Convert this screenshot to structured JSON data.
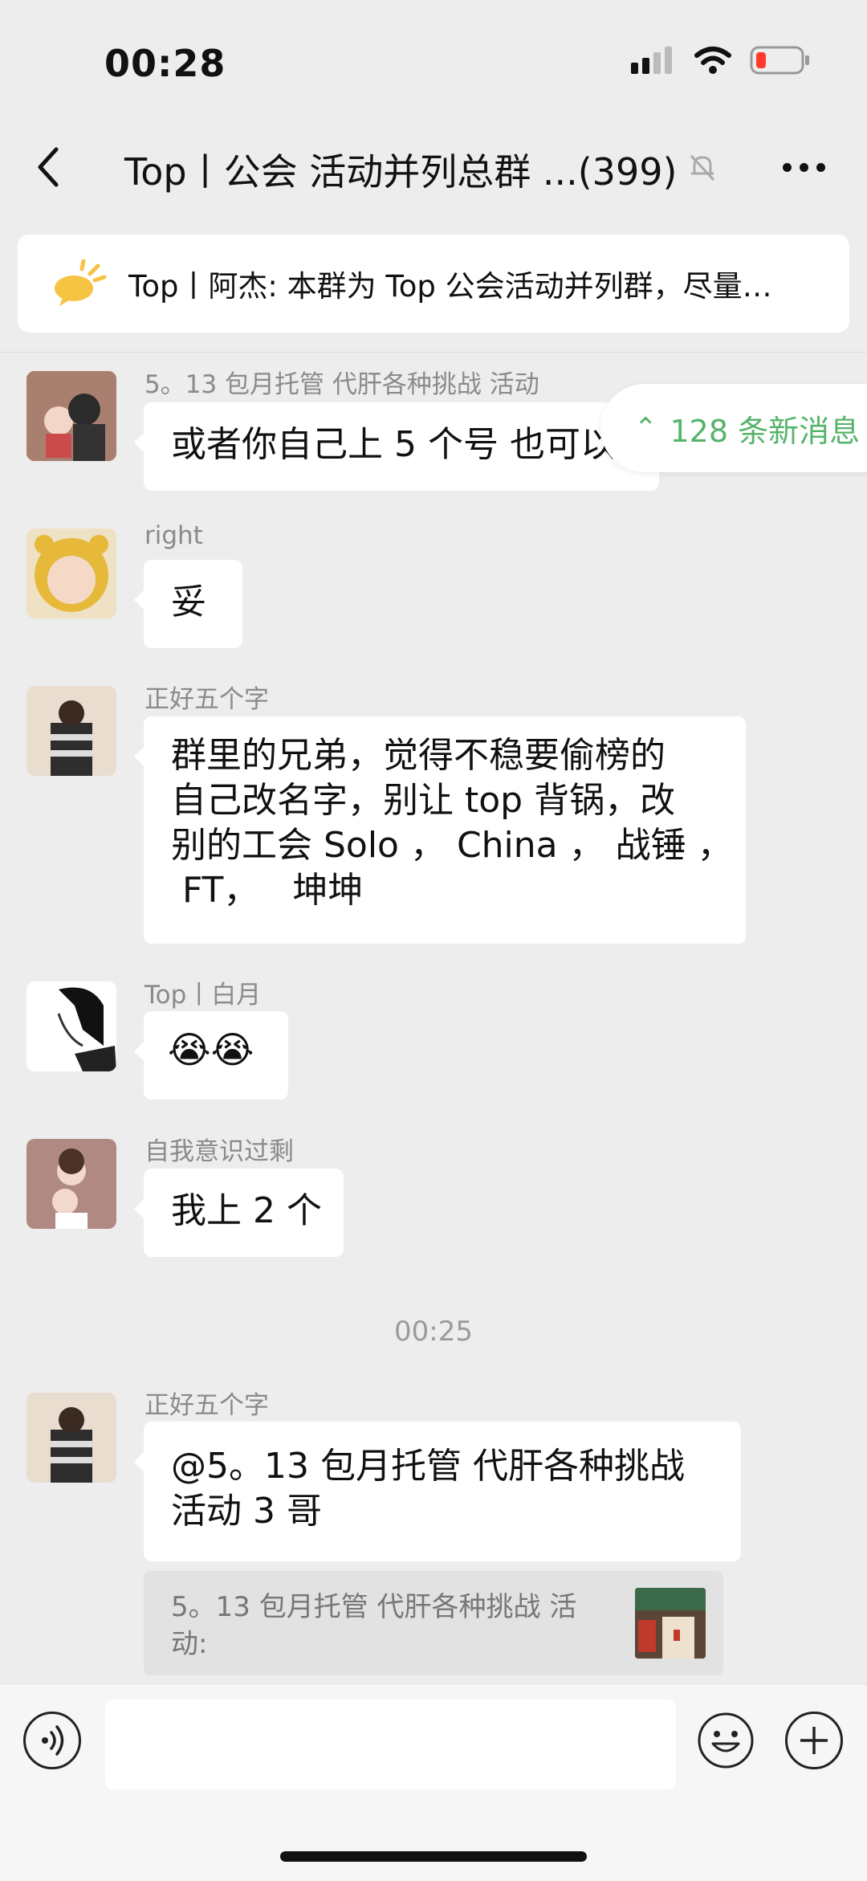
{
  "status_bar": {
    "time": "00:28",
    "icons": [
      "signal-icon",
      "wifi-icon",
      "battery-icon"
    ]
  },
  "nav": {
    "title": "Top丨公会 活动并列总群 ...(399)",
    "icons": [
      "back-icon",
      "mute-bell-icon",
      "more-icon"
    ]
  },
  "announcement": {
    "text": "Top丨阿杰: 本群为 Top 公会活动并列群，尽量…"
  },
  "new_messages_pill": "128 条新消息",
  "messages": [
    {
      "sender": "5。13 包月托管 代肝各种挑战 活动",
      "text": "或者你自己上 5 个号 也可以"
    },
    {
      "sender": "right",
      "text": "妥"
    },
    {
      "sender": "正好五个字",
      "lines": [
        "群里的兄弟，觉得不稳要偷榜的",
        "自己改名字，别让 top 背锅，改",
        "别的工会 Solo ， China ， 战锤 ，",
        " FT，   坤坤"
      ]
    },
    {
      "sender": "Top丨白月",
      "text": "😭😭"
    },
    {
      "sender": "自我意识过剩",
      "text": "我上 2 个"
    },
    {
      "sender": "正好五个字",
      "lines": [
        "@5。13 包月托管 代肝各种挑战",
        "活动 3 哥"
      ]
    }
  ],
  "time_divider": "00:25",
  "quote": {
    "lines": [
      "5。13 包月托管 代肝各种挑战 活",
      "动:"
    ]
  },
  "input": {
    "placeholder": ""
  },
  "colors": {
    "background": "#ededed",
    "bubble": "#ffffff",
    "accent_green": "#56b46a",
    "muted_text": "#8a8a8a"
  }
}
